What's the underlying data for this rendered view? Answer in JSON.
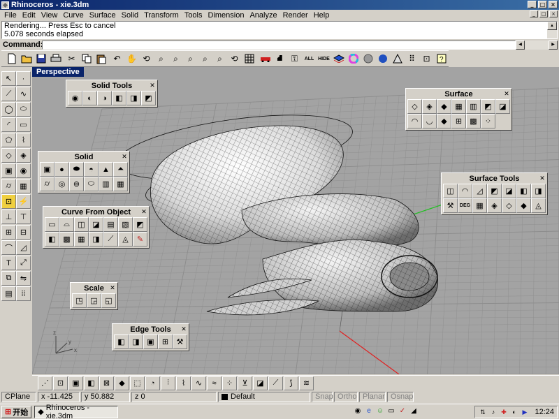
{
  "window": {
    "title": "Rhinoceros - xie.3dm"
  },
  "menu": {
    "items": [
      {
        "label": "File"
      },
      {
        "label": "Edit"
      },
      {
        "label": "View"
      },
      {
        "label": "Curve"
      },
      {
        "label": "Surface"
      },
      {
        "label": "Solid"
      },
      {
        "label": "Transform"
      },
      {
        "label": "Tools"
      },
      {
        "label": "Dimension"
      },
      {
        "label": "Analyze"
      },
      {
        "label": "Render"
      },
      {
        "label": "Help"
      }
    ]
  },
  "history": {
    "line1": "Rendering... Press Esc to cancel",
    "line2": "5.078 seconds elapsed"
  },
  "command": {
    "label": "Command:",
    "value": ""
  },
  "toolbar": {
    "all_label": "ALL",
    "hide_label": "HIDE"
  },
  "viewport": {
    "label": "Perspective"
  },
  "palettes": {
    "solid_tools": "Solid Tools",
    "solid": "Solid",
    "curve_from_object": "Curve From Object",
    "scale": "Scale",
    "edge_tools": "Edge Tools",
    "surface": "Surface",
    "surface_tools": "Surface Tools",
    "deg_label": "DEG"
  },
  "status": {
    "cplane": "CPlane",
    "x": "x -11.425",
    "y": "y 50.882",
    "z": "z 0",
    "layer": "Default",
    "snap": "Snap",
    "ortho": "Ortho",
    "planar": "Planar",
    "osnap": "Osnap"
  },
  "taskbar": {
    "start": "开始",
    "task": "Rhinoceros - xie.3dm",
    "clock": "12:24"
  },
  "colors": {
    "titlebar": "#0a246a",
    "viewport_bg": "#a3a3a3",
    "grid_line": "#8c8c8c",
    "axis_x": "#e02020",
    "axis_y": "#20c020",
    "model_fill": "#e6e6e6",
    "wire": "#111111"
  }
}
